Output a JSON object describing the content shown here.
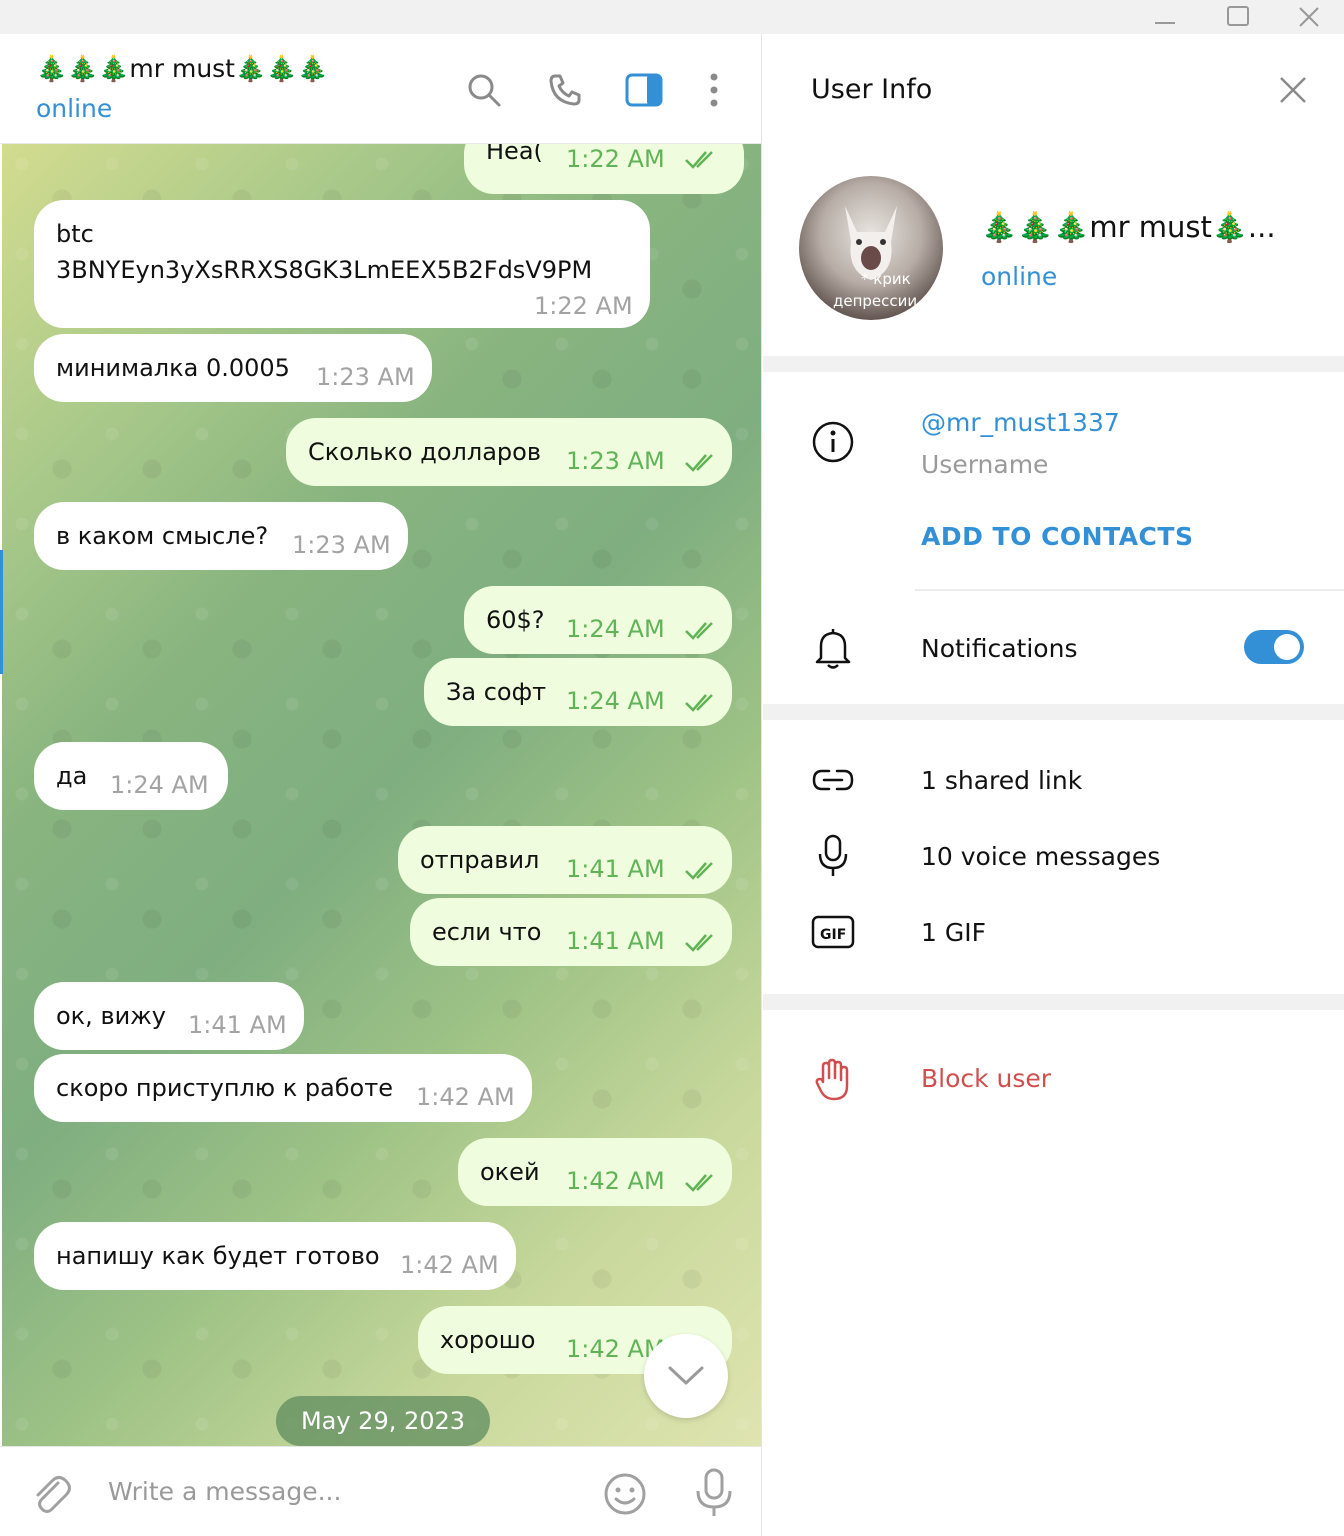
{
  "window": {
    "minimize_icon": "minimize-icon",
    "maximize_icon": "maximize-icon",
    "close_icon": "close-icon"
  },
  "chat": {
    "name": "🎄🎄🎄mr must🎄🎄🎄",
    "status": "online",
    "icons": [
      "search-icon",
      "phone-icon",
      "sidebar-toggle-icon",
      "more-vertical-icon"
    ],
    "messages": [
      {
        "dir": "out",
        "text": "Неа(",
        "time": "1:22 AM",
        "read": true
      },
      {
        "dir": "in",
        "text_line1": "btc",
        "text_line2": "3BNYEyn3yXsRRXS8GK3LmEEX5B2FdsV9PM",
        "time": "1:22 AM"
      },
      {
        "dir": "in",
        "text": "минималка 0.0005",
        "time": "1:23 AM"
      },
      {
        "dir": "out",
        "text": "Сколько долларов",
        "time": "1:23 AM",
        "read": true
      },
      {
        "dir": "in",
        "text": "в каком смысле?",
        "time": "1:23 AM"
      },
      {
        "dir": "out",
        "text": "60$?",
        "time": "1:24 AM",
        "read": true
      },
      {
        "dir": "out",
        "text": "За софт",
        "time": "1:24 AM",
        "read": true
      },
      {
        "dir": "in",
        "text": "да",
        "time": "1:24 AM"
      },
      {
        "dir": "out",
        "text": "отправил",
        "time": "1:41 AM",
        "read": true
      },
      {
        "dir": "out",
        "text": "если что",
        "time": "1:41 AM",
        "read": true
      },
      {
        "dir": "in",
        "text": "ок, вижу",
        "time": "1:41 AM"
      },
      {
        "dir": "in",
        "text": "скоро приступлю к работе",
        "time": "1:42 AM"
      },
      {
        "dir": "out",
        "text": "окей",
        "time": "1:42 AM",
        "read": true
      },
      {
        "dir": "in",
        "text": "напишу как будет готово",
        "time": "1:42 AM"
      },
      {
        "dir": "out",
        "text": "хорошо",
        "time": "1:42 AM",
        "read": true
      }
    ],
    "date_separator": "May 29, 2023",
    "composer_placeholder": "Write a message...",
    "composer_icons": [
      "attach-icon",
      "emoji-icon",
      "microphone-icon"
    ]
  },
  "info": {
    "title": "User Info",
    "name": "🎄🎄🎄mr must🎄...",
    "status": "online",
    "avatar_caption_line1": "* крик",
    "avatar_caption_line2": "депрессии",
    "username": "@mr_must1337",
    "username_label": "Username",
    "add_contact": "ADD TO CONTACTS",
    "notifications_label": "Notifications",
    "notifications_enabled": true,
    "media": [
      {
        "icon": "link-icon",
        "label": "1 shared link"
      },
      {
        "icon": "microphone-icon",
        "label": "10 voice messages"
      },
      {
        "icon": "gif-icon",
        "label": "1 GIF"
      }
    ],
    "block_label": "Block user",
    "colors": {
      "accent": "#3390d6",
      "danger": "#d14e4e",
      "outgoing_time": "#60b456"
    }
  }
}
